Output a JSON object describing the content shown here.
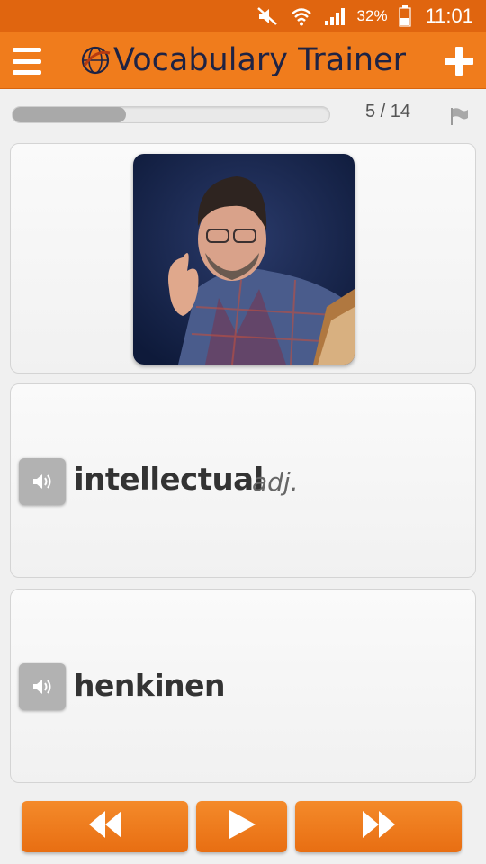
{
  "status_bar": {
    "battery_percent": "32%",
    "time": "11:01",
    "icons": [
      "mute-icon",
      "wifi-icon",
      "signal-icon",
      "battery-icon"
    ]
  },
  "app_bar": {
    "title": "Vocabulary Trainer",
    "menu_icon": "hamburger-menu-icon",
    "logo_icon": "globe-logo-icon",
    "add_icon": "plus-icon"
  },
  "progress": {
    "current": 5,
    "total": 14,
    "label": "5 / 14",
    "flag_icon": "flag-icon"
  },
  "image_card": {
    "icon": "photo-image"
  },
  "word_card_1": {
    "word": "intellectual",
    "part_of_speech": "adj.",
    "audio_icon": "speaker-icon"
  },
  "word_card_2": {
    "word": "henkinen",
    "audio_icon": "speaker-icon"
  },
  "bottom_nav": {
    "prev_icon": "rewind-icon",
    "play_icon": "play-icon",
    "next_icon": "fast-forward-icon"
  },
  "colors": {
    "status_bar": "#e0650f",
    "app_bar": "#f07c1c",
    "title_text": "#1e2344",
    "nav_button": "#f07c1c"
  }
}
